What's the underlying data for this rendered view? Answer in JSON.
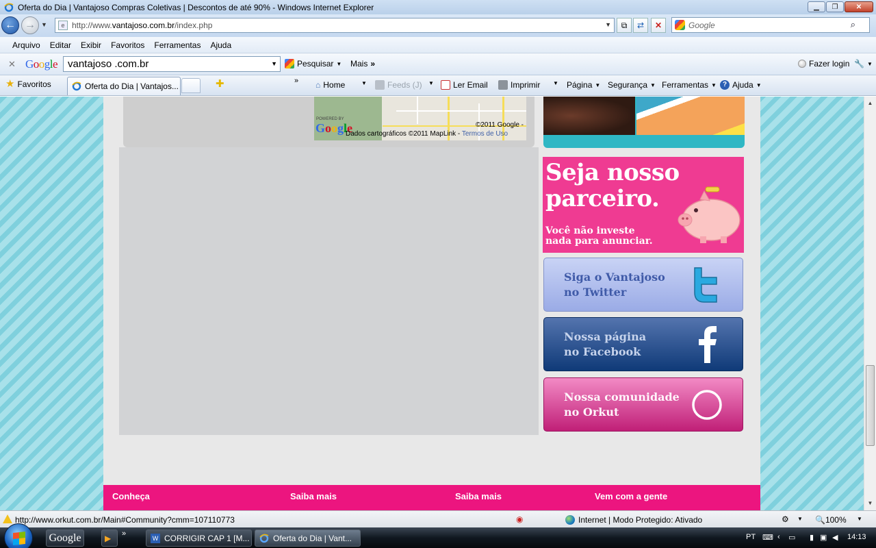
{
  "window": {
    "title": "Oferta do Dia | Vantajoso Compras Coletivas | Descontos de até 90% - Windows Internet Explorer",
    "buttons": [
      "minimize",
      "restore",
      "close"
    ]
  },
  "address": {
    "url_prefix": "http://www.",
    "url_host": "vantajoso.com.br",
    "url_path": "/index.php",
    "search_placeholder": "Google"
  },
  "menu": [
    "Arquivo",
    "Editar",
    "Exibir",
    "Favoritos",
    "Ferramentas",
    "Ajuda"
  ],
  "google_toolbar": {
    "logo": "Google",
    "query": "vantajoso .com.br",
    "search_label": "Pesquisar",
    "more_label": "Mais",
    "login_label": "Fazer login"
  },
  "favorites_bar": {
    "favorites_label": "Favoritos",
    "tab_title": "Oferta do Dia | Vantajos...",
    "commands": {
      "home": "Home",
      "feeds": "Feeds (J)",
      "email": "Ler Email",
      "print": "Imprimir",
      "page": "Página",
      "security": "Segurança",
      "tools": "Ferramentas",
      "help": "Ajuda"
    }
  },
  "map": {
    "powered_by": "POWERED BY",
    "logo": "Google",
    "copyright": "©2011 Google -",
    "carto_text": "Dados cartográficos ©2011 MapLink -",
    "terms_link": "Termos de Uso"
  },
  "sidebar": {
    "partner": {
      "headline_line1": "Seja nosso",
      "headline_line2": "parceiro.",
      "sub_line1": "Você não investe",
      "sub_line2": "nada para anunciar."
    },
    "twitter": {
      "line1": "Siga o Vantajoso",
      "line2": "no Twitter"
    },
    "facebook": {
      "line1": "Nossa página",
      "line2": "no Facebook"
    },
    "orkut": {
      "line1": "Nossa comunidade",
      "line2": "no Orkut"
    }
  },
  "footer": {
    "links": [
      "Conheça",
      "Saiba mais",
      "Saiba mais",
      "Vem com a gente"
    ]
  },
  "statusbar": {
    "url": "http://www.orkut.com.br/Main#Community?cmm=107110773",
    "zone": "Internet | Modo Protegido: Ativado",
    "zoom": "100%"
  },
  "taskbar": {
    "google_button": "Google",
    "task1": "CORRIGIR CAP 1 [M...",
    "task2": "Oferta do Dia | Vant...",
    "lang": "PT",
    "clock": "14:13"
  },
  "colors": {
    "brand_pink": "#ec157f",
    "partner_pink": "#ef3b92",
    "stripe_teal": "#7fd0dd",
    "twitter_blue": "#9aabe6",
    "facebook_blue": "#0f3a78",
    "orkut_pink": "#c01f77"
  }
}
